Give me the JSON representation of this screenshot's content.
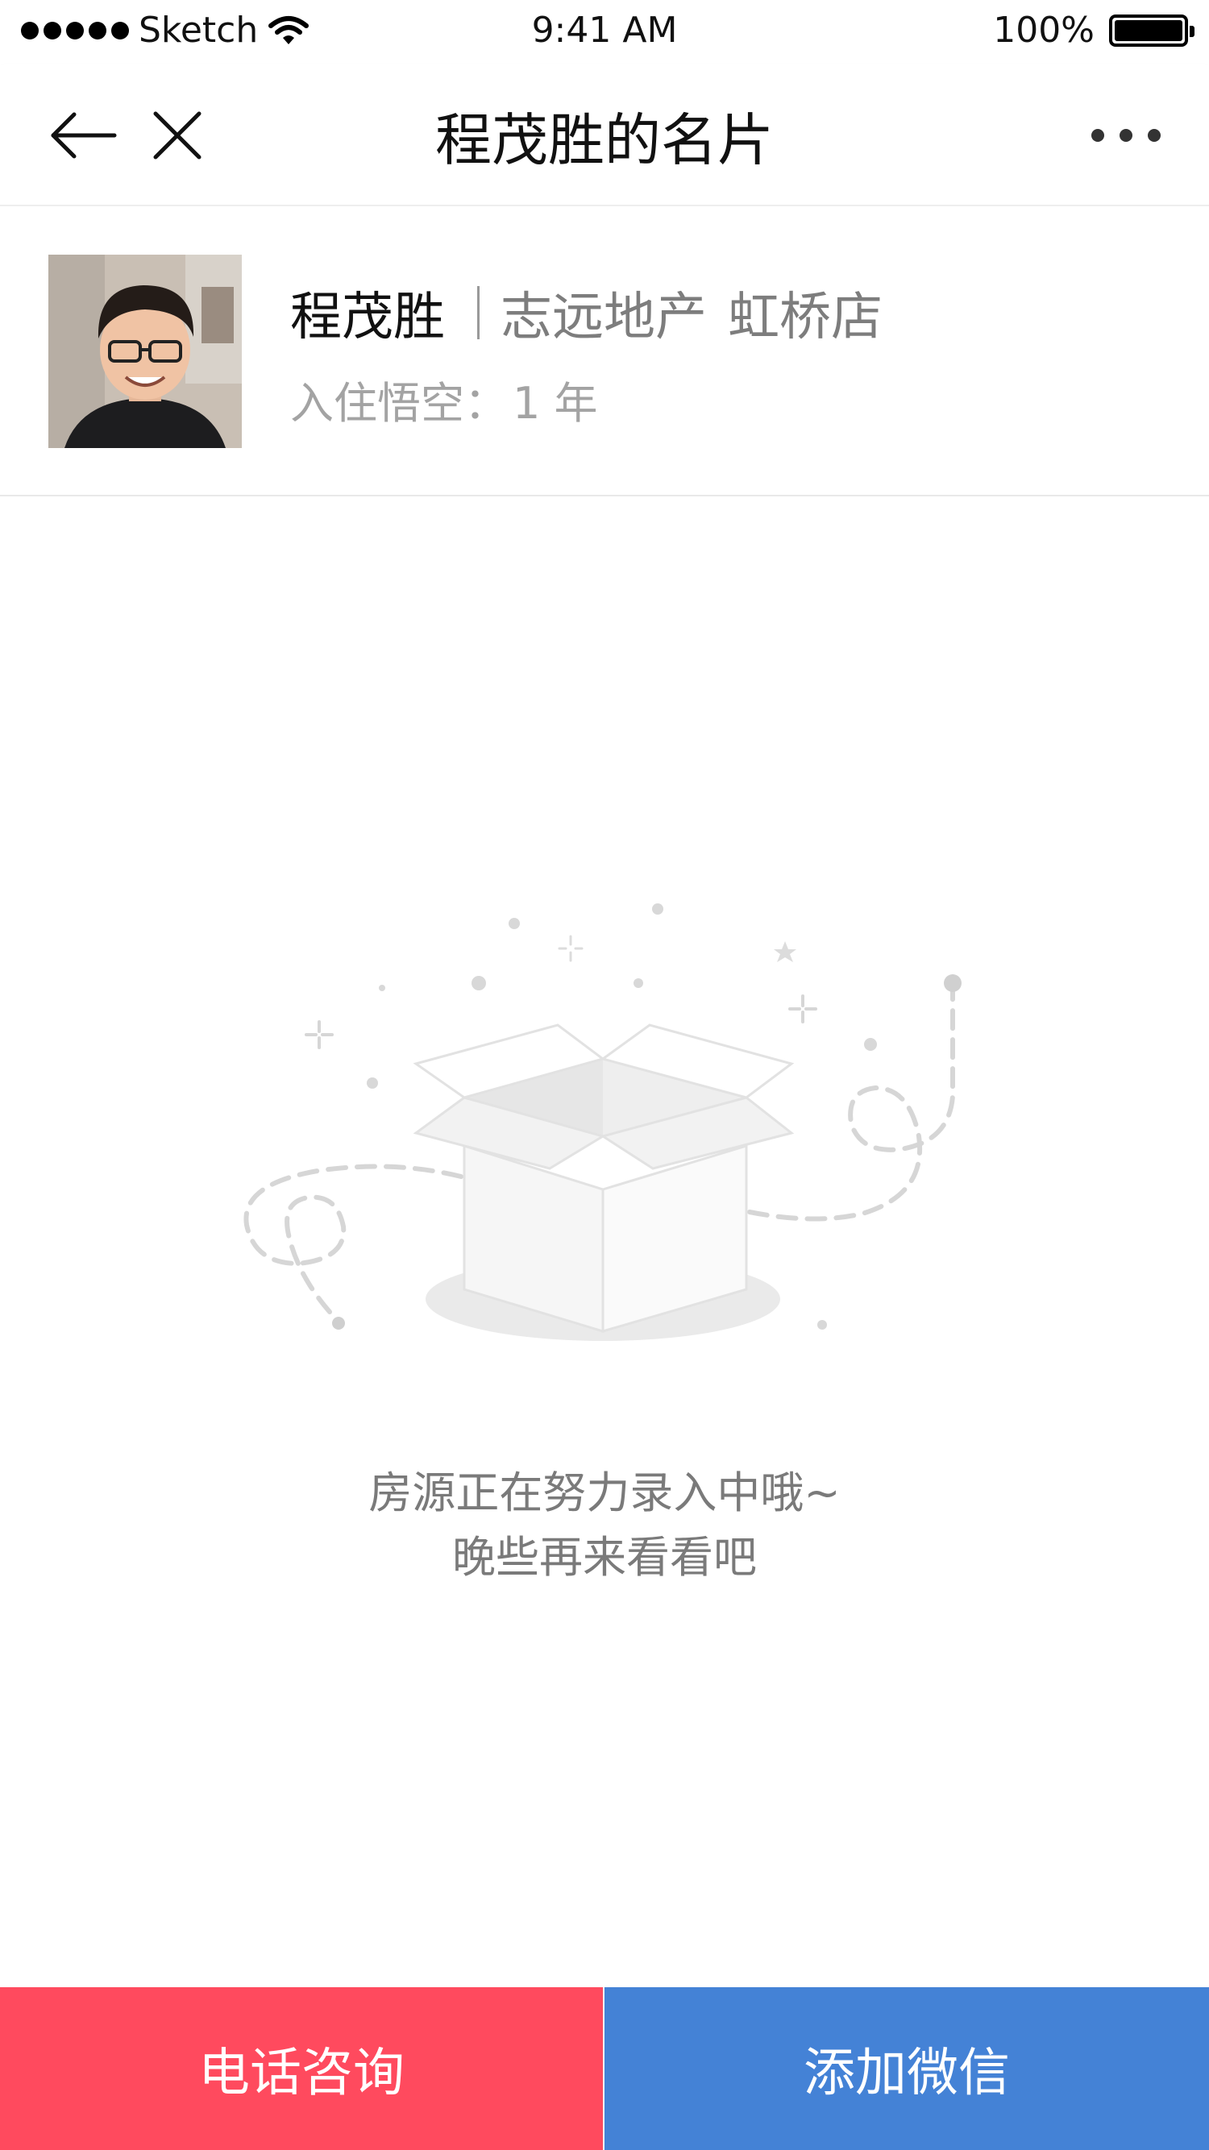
{
  "status_bar": {
    "carrier": "Sketch",
    "time": "9:41 AM",
    "battery_percent": "100%",
    "battery_level": 1.0,
    "icons": [
      "signal-dots-icon",
      "wifi-icon",
      "battery-icon"
    ]
  },
  "nav": {
    "title": "程茂胜的名片",
    "icons": [
      "back-arrow-icon",
      "close-icon",
      "more-icon"
    ]
  },
  "profile": {
    "name": "程茂胜",
    "company": "志远地产",
    "store": "虹桥店",
    "tenure_label": "入住悟空：",
    "tenure_value": "1 年"
  },
  "empty_state": {
    "line1": "房源正在努力录入中哦~",
    "line2": "晚些再来看看吧",
    "illustration": "empty-box-icon"
  },
  "actions": {
    "call_label": "电话咨询",
    "wechat_label": "添加微信"
  },
  "colors": {
    "call_button": "#FF4A5E",
    "wechat_button": "#4482D6",
    "illustration_gray": "#E6E6E6"
  }
}
